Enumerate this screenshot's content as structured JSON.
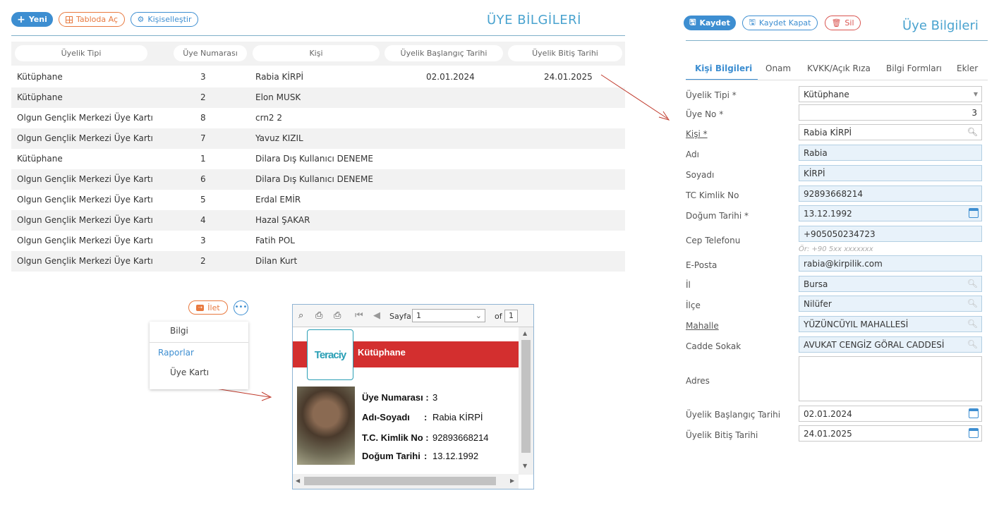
{
  "toolbar_left": {
    "new": "Yeni",
    "table": "Tabloda Aç",
    "customize": "Kişiselleştir"
  },
  "title_left": "ÜYE BİLGİLERİ",
  "table": {
    "columns": [
      "Üyelik Tipi",
      "Üye Numarası",
      "Kişi",
      "Üyelik Başlangıç Tarihi",
      "Üyelik Bitiş Tarihi"
    ],
    "rows": [
      [
        "Kütüphane",
        "3",
        "Rabia KİRPİ",
        "02.01.2024",
        "24.01.2025"
      ],
      [
        "Kütüphane",
        "2",
        "Elon MUSK",
        "",
        ""
      ],
      [
        "Olgun Gençlik Merkezi Üye Kartı",
        "8",
        "crn2 2",
        "",
        ""
      ],
      [
        "Olgun Gençlik Merkezi Üye Kartı",
        "7",
        "Yavuz KIZIL",
        "",
        ""
      ],
      [
        "Kütüphane",
        "1",
        "Dilara Dış Kullanıcı DENEME",
        "",
        ""
      ],
      [
        "Olgun Gençlik Merkezi Üye Kartı",
        "6",
        "Dilara Dış Kullanıcı DENEME",
        "",
        ""
      ],
      [
        "Olgun Gençlik Merkezi Üye Kartı",
        "5",
        "Erdal EMİR",
        "",
        ""
      ],
      [
        "Olgun Gençlik Merkezi Üye Kartı",
        "4",
        "Hazal ŞAKAR",
        "",
        ""
      ],
      [
        "Olgun Gençlik Merkezi Üye Kartı",
        "3",
        "Fatih POL",
        "",
        ""
      ],
      [
        "Olgun Gençlik Merkezi Üye Kartı",
        "2",
        "Dilan Kurt",
        "",
        ""
      ]
    ]
  },
  "forward_button": "İlet",
  "menu": {
    "info": "Bilgi",
    "reports": "Raporlar",
    "card": "Üye Kartı"
  },
  "viewer": {
    "page_label": "Sayfa",
    "page_value": "1",
    "of_label": "of",
    "total_pages": "1",
    "logo_text": "Teraciy",
    "card_title": "Kütüphane",
    "fields": [
      {
        "label": "Üye Numarası :",
        "value": "3"
      },
      {
        "label": "Adı-Soyadı",
        "sep": ":",
        "value": "Rabia KİRPİ"
      },
      {
        "label": "T.C. Kimlik No :",
        "value": "92893668214"
      },
      {
        "label": "Doğum Tarihi",
        "sep": ":",
        "value": "13.12.1992"
      }
    ]
  },
  "toolbar_right": {
    "save": "Kaydet",
    "save_close": "Kaydet Kapat",
    "delete": "Sil"
  },
  "title_right": "Üye Bilgileri",
  "tabs": [
    "Kişi Bilgileri",
    "Onam",
    "KVKK/Açık Rıza",
    "Bilgi Formları",
    "Ekler"
  ],
  "form": {
    "membership_type": {
      "label": "Üyelik Tipi *",
      "value": "Kütüphane"
    },
    "member_no": {
      "label": "Üye No *",
      "value": "3"
    },
    "person": {
      "label": "Kişi *",
      "value": "Rabia KİRPİ"
    },
    "first_name": {
      "label": "Adı",
      "value": "Rabia"
    },
    "last_name": {
      "label": "Soyadı",
      "value": "KİRPİ"
    },
    "tc_no": {
      "label": "TC Kimlik No",
      "value": "92893668214"
    },
    "birth_date": {
      "label": "Doğum Tarihi *",
      "value": "13.12.1992"
    },
    "mobile": {
      "label": "Cep Telefonu",
      "value": "+905050234723",
      "hint": "Ör: +90 5xx xxxxxxx"
    },
    "email": {
      "label": "E-Posta",
      "value": "rabia@kirpilik.com"
    },
    "city": {
      "label": "İl",
      "value": "Bursa"
    },
    "district": {
      "label": "İlçe",
      "value": "Nilüfer"
    },
    "neighborhood": {
      "label": "Mahalle",
      "value": "YÜZÜNCÜYIL MAHALLESİ"
    },
    "street": {
      "label": "Cadde Sokak",
      "value": "AVUKAT CENGİZ GÖRAL CADDESİ"
    },
    "address": {
      "label": "Adres",
      "value": ""
    },
    "start_date": {
      "label": "Üyelik Başlangıç Tarihi",
      "value": "02.01.2024"
    },
    "end_date": {
      "label": "Üyelik Bitiş Tarihi",
      "value": "24.01.2025"
    }
  },
  "colors": {
    "accent": "#3d8ed1",
    "orange": "#e8793f",
    "red_banner": "#d32f2f",
    "annotation": "#c0392b"
  }
}
